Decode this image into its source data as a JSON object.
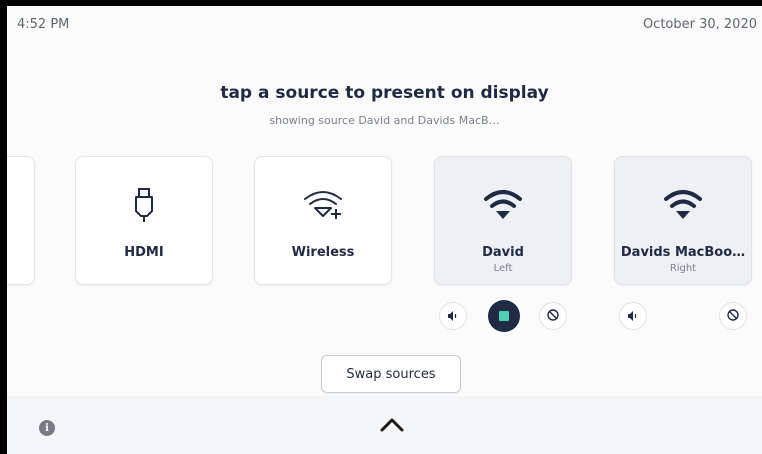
{
  "status_bar": {
    "time": "4:52 PM",
    "date": "October 30, 2020"
  },
  "header": {
    "title": "tap a source to present on display",
    "subtitle": "showing source David and Davids MacB…"
  },
  "sources": [
    {
      "name": "",
      "sub": "",
      "icon": "partial-card"
    },
    {
      "name": "HDMI",
      "sub": "",
      "icon": "hdmi-plug-icon"
    },
    {
      "name": "Wireless",
      "sub": "",
      "icon": "wireless-add-icon"
    },
    {
      "name": "David",
      "sub": "Left",
      "icon": "wifi-icon",
      "active": true
    },
    {
      "name": "Davids MacBoo…",
      "sub": "Right",
      "icon": "wifi-icon",
      "active": true
    }
  ],
  "controls": {
    "left": [
      "volume-icon",
      "stop-button",
      "disable-icon"
    ],
    "right": [
      "volume-icon",
      "disable-icon"
    ]
  },
  "actions": {
    "swap_label": "Swap sources"
  },
  "footer": {
    "info_icon": "info-icon",
    "expand_icon": "chevron-up-icon"
  },
  "colors": {
    "text": "#1f2a44",
    "accent": "#4fd1b5",
    "muted": "#7a818c"
  }
}
